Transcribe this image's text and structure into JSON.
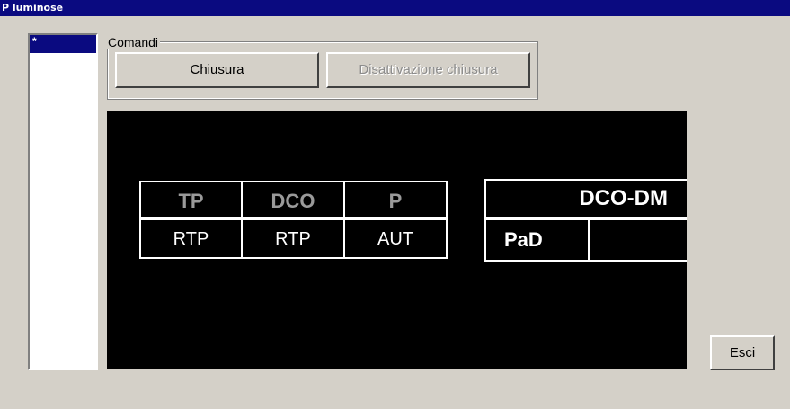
{
  "window": {
    "title": "P luminose"
  },
  "list": {
    "items": [
      {
        "label": "*"
      }
    ]
  },
  "commands": {
    "legend": "Comandi",
    "close_label": "Chiusura",
    "disable_close_label": "Disattivazione chiusura"
  },
  "panel": {
    "headers": [
      "TP",
      "DCO",
      "P"
    ],
    "values": [
      "RTP",
      "RTP",
      "AUT"
    ],
    "dco_dm": "DCO-DM",
    "pad": "PaD",
    "pad_value": ""
  },
  "footer": {
    "exit_label": "Esci"
  },
  "colors": {
    "titlebar": "#0a0a80",
    "background": "#d4d0c8",
    "display": "#000000",
    "header_text": "#9a9a9a"
  }
}
